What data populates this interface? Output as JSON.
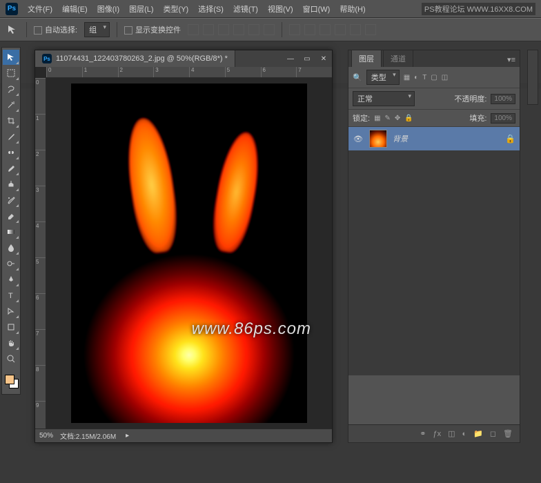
{
  "menu": {
    "items": [
      "文件(F)",
      "编辑(E)",
      "图像(I)",
      "图层(L)",
      "类型(Y)",
      "选择(S)",
      "滤镜(T)",
      "视图(V)",
      "窗口(W)",
      "帮助(H)"
    ]
  },
  "watermark_top": "PS教程论坛  WWW.16XX8.COM",
  "options": {
    "auto_select": "自动选择:",
    "group": "组",
    "show_transform": "显示变换控件"
  },
  "doc": {
    "tab": "11074431_122403780263_2.jpg @ 50%(RGB/8*) *",
    "zoom": "50%",
    "docinfo": "文档:2.15M/2.06M",
    "ruler_h": [
      "0",
      "1",
      "2",
      "3",
      "4",
      "5",
      "6",
      "7"
    ],
    "ruler_v": [
      "0",
      "1",
      "2",
      "3",
      "4",
      "5",
      "6",
      "7",
      "8",
      "9"
    ]
  },
  "wm": "www.86ps.com",
  "panel": {
    "tab1": "图层",
    "tab2": "通道",
    "kind": "类型",
    "blend": "正常",
    "opacity_lbl": "不透明度:",
    "opacity_val": "100%",
    "lock_lbl": "锁定:",
    "fill_lbl": "填充:",
    "fill_val": "100%",
    "layer_name": "背景",
    "search": "🔍"
  },
  "tools": [
    "↖",
    "▭",
    "✧",
    "✱",
    "⟀",
    "✎",
    "◉",
    "☒",
    "⌫",
    "◌",
    "⟋",
    "⊿",
    "T",
    "▷",
    "▯",
    "✋",
    "🔍"
  ]
}
